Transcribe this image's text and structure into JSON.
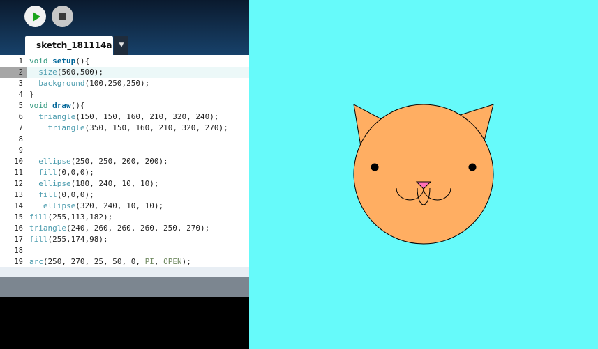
{
  "toolbar": {
    "run_icon": "play-icon",
    "stop_icon": "stop-icon"
  },
  "tab": {
    "title": "sketch_181114a",
    "menu_icon": "▼"
  },
  "editor": {
    "current_line": 2,
    "lines": [
      "void setup(){",
      "  size(500,500);",
      "  background(100,250,250);",
      "}",
      "void draw(){",
      "  triangle(150, 150, 160, 210, 320, 240);",
      "    triangle(350, 150, 160, 210, 320, 270);",
      "",
      "",
      "  ellipse(250, 250, 200, 200);",
      "  fill(0,0,0);",
      "  ellipse(180, 240, 10, 10);",
      "  fill(0,0,0);",
      "   ellipse(320, 240, 10, 10);",
      "fill(255,113,182);",
      "triangle(240, 260, 260, 260, 250, 270);",
      "fill(255,174,98);",
      "",
      "arc(250, 270, 25, 50, 0, PI, OPEN);"
    ]
  },
  "sketch": {
    "background": "#66fafa",
    "face_fill": "#ffae62",
    "nose_fill": "#ff71b6",
    "eye_fill": "#000000"
  }
}
